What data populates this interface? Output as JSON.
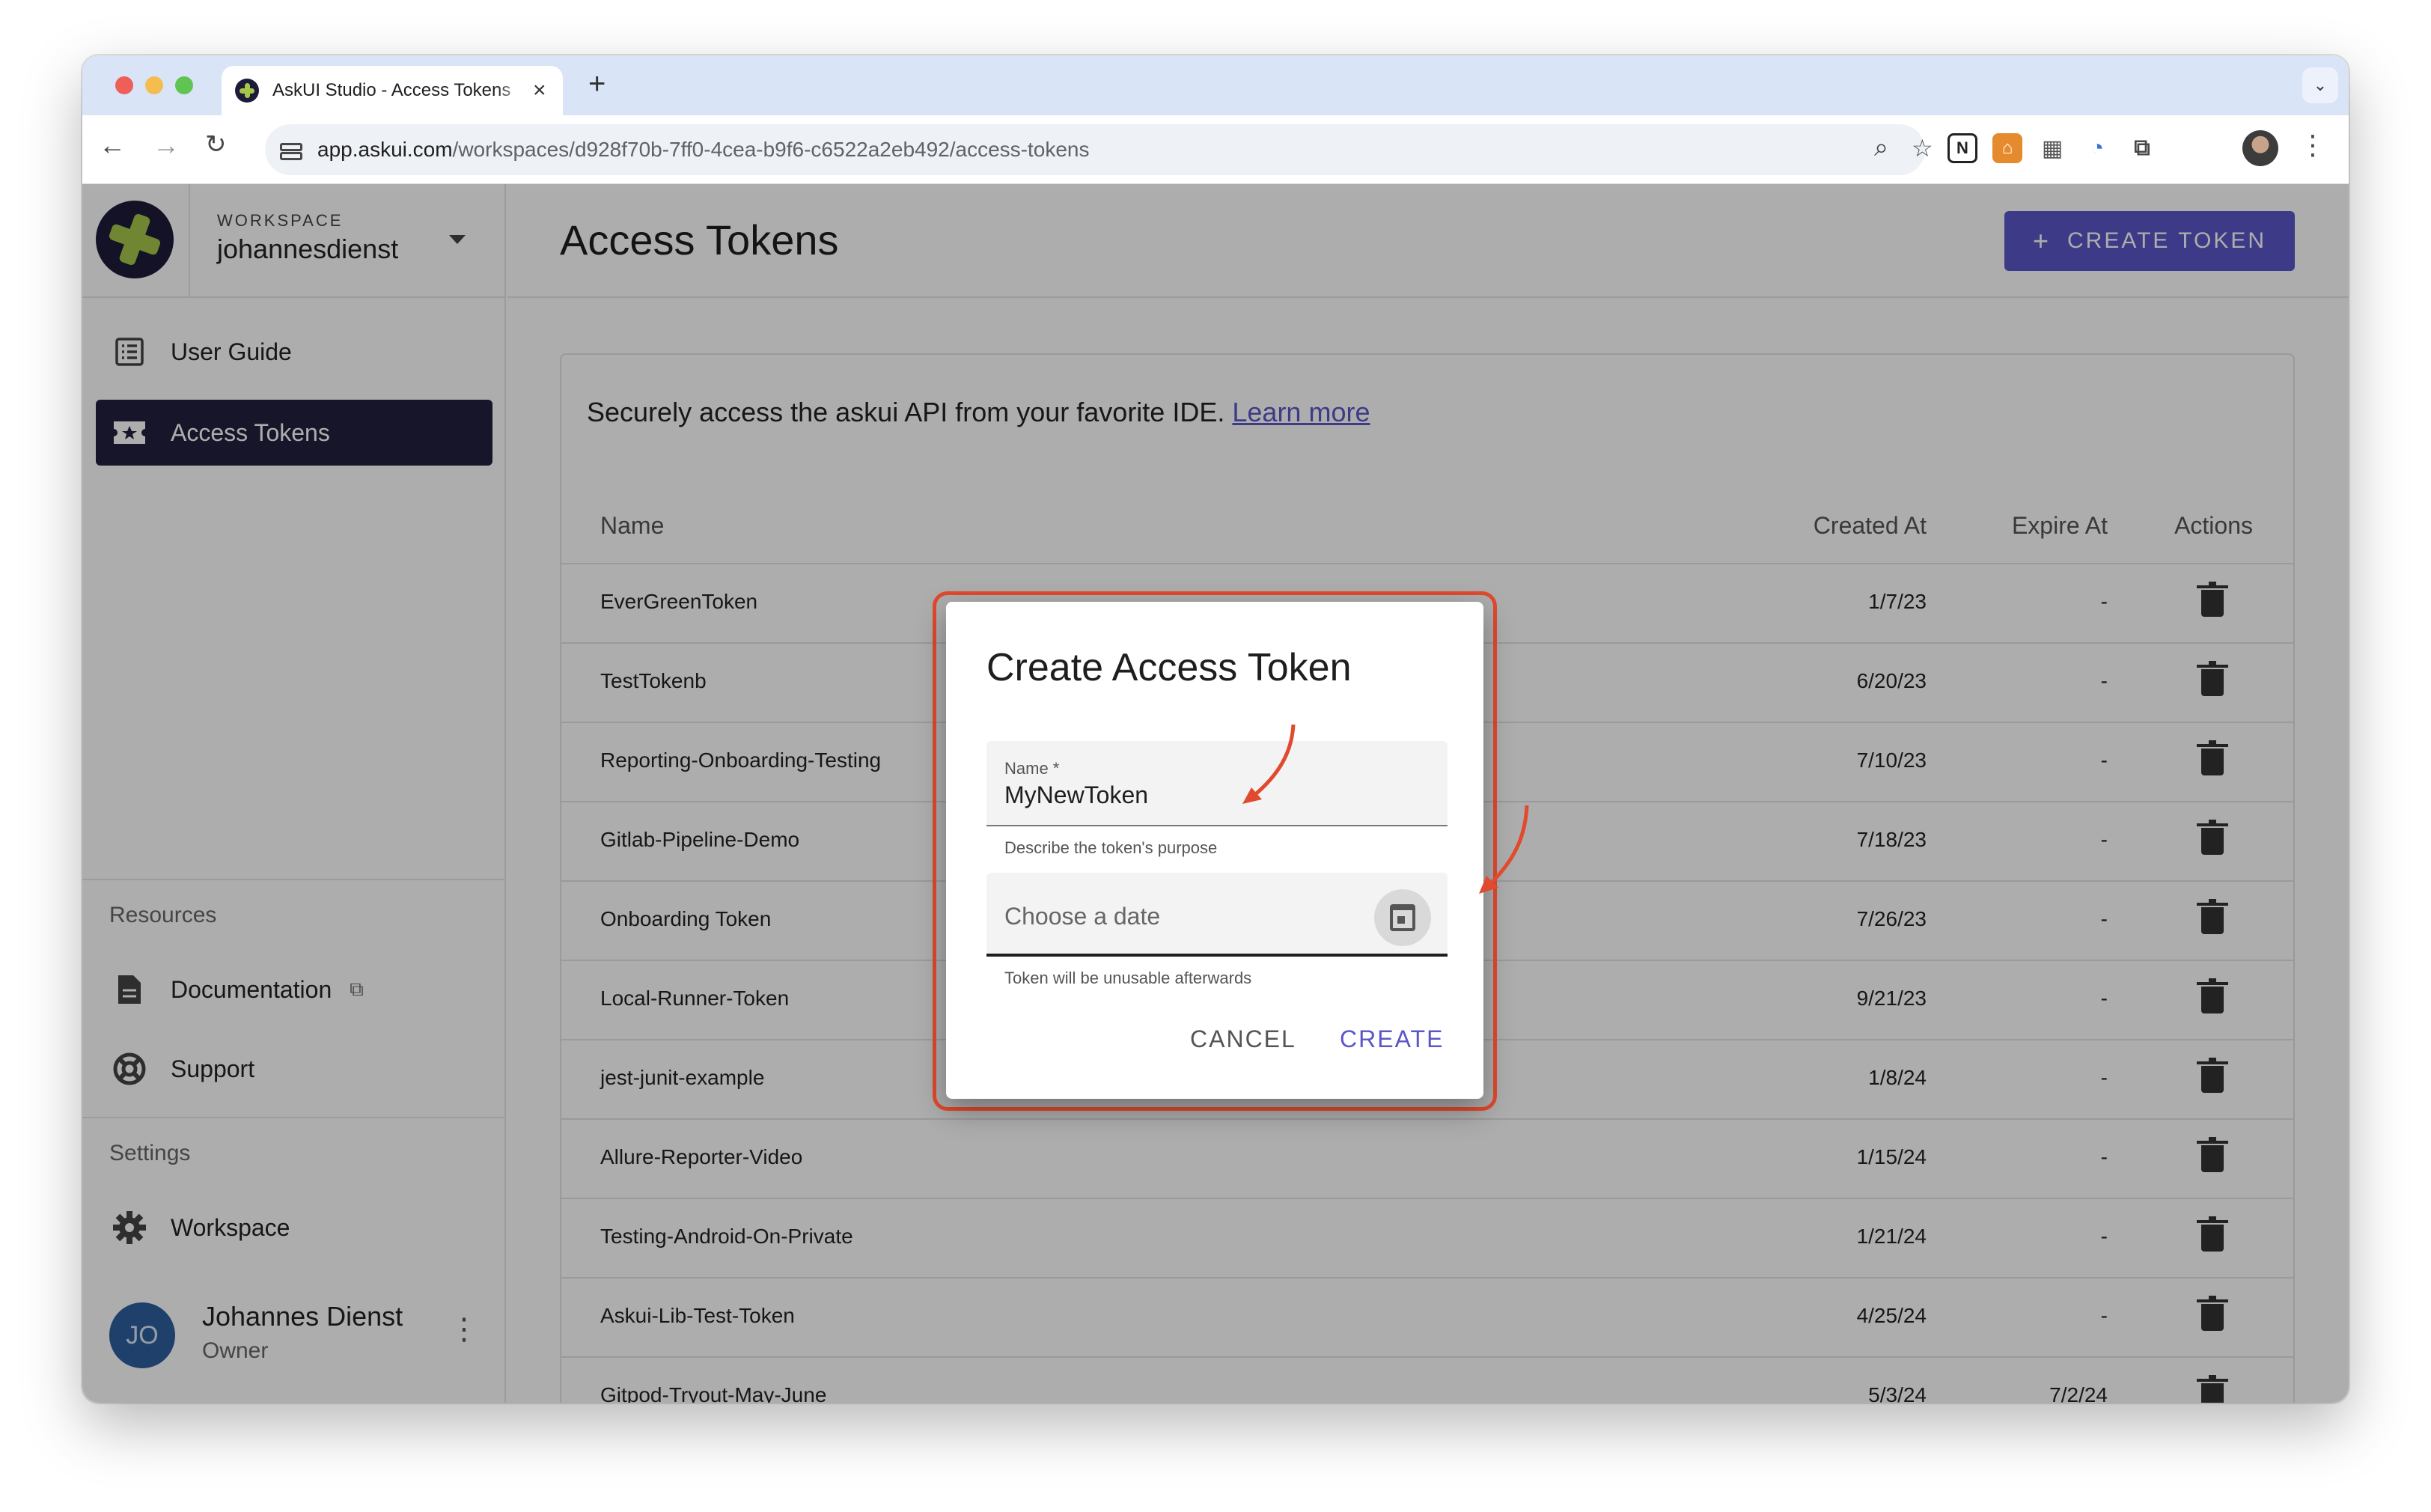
{
  "browser": {
    "tab_title": "AskUI Studio - Access Tokens",
    "tab_close": "×",
    "new_tab": "+",
    "url_host": "app.askui.com",
    "url_path": "/workspaces/d928f70b-7ff0-4cea-b9f6-c6522a2eb492/access-tokens"
  },
  "workspace": {
    "label": "WORKSPACE",
    "name": "johannesdienst"
  },
  "sidebar": {
    "items": [
      {
        "label": "User Guide"
      },
      {
        "label": "Access Tokens"
      }
    ],
    "resources_title": "Resources",
    "resources": [
      {
        "label": "Documentation"
      },
      {
        "label": "Support"
      }
    ],
    "settings_title": "Settings",
    "settings": [
      {
        "label": "Workspace"
      }
    ],
    "user": {
      "initials": "JO",
      "name": "Johannes Dienst",
      "role": "Owner"
    }
  },
  "main": {
    "title": "Access Tokens",
    "create_button": "CREATE TOKEN",
    "intro_text": "Securely access the askui API from your favorite IDE.",
    "learn_more": "Learn more",
    "columns": {
      "name": "Name",
      "created": "Created At",
      "expire": "Expire At",
      "actions": "Actions"
    },
    "rows": [
      {
        "name": "EverGreenToken",
        "created": "1/7/23",
        "expire": "-"
      },
      {
        "name": "TestTokenb",
        "created": "6/20/23",
        "expire": "-"
      },
      {
        "name": "Reporting-Onboarding-Testing",
        "created": "7/10/23",
        "expire": "-"
      },
      {
        "name": "Gitlab-Pipeline-Demo",
        "created": "7/18/23",
        "expire": "-"
      },
      {
        "name": "Onboarding Token",
        "created": "7/26/23",
        "expire": "-"
      },
      {
        "name": "Local-Runner-Token",
        "created": "9/21/23",
        "expire": "-"
      },
      {
        "name": "jest-junit-example",
        "created": "1/8/24",
        "expire": "-"
      },
      {
        "name": "Allure-Reporter-Video",
        "created": "1/15/24",
        "expire": "-"
      },
      {
        "name": "Testing-Android-On-Private",
        "created": "1/21/24",
        "expire": "-"
      },
      {
        "name": "Askui-Lib-Test-Token",
        "created": "4/25/24",
        "expire": "-"
      },
      {
        "name": "Gitpod-Tryout-May-June",
        "created": "5/3/24",
        "expire": "7/2/24"
      }
    ]
  },
  "dialog": {
    "title": "Create Access Token",
    "name_label": "Name *",
    "name_value": "MyNewToken",
    "name_hint": "Describe the token's purpose",
    "date_placeholder": "Choose a date",
    "date_hint": "Token will be unusable afterwards",
    "cancel": "CANCEL",
    "create": "CREATE"
  },
  "colors": {
    "accent": "#5b57c8",
    "nav_active": "#22203d",
    "annotation": "#e14a2e"
  }
}
